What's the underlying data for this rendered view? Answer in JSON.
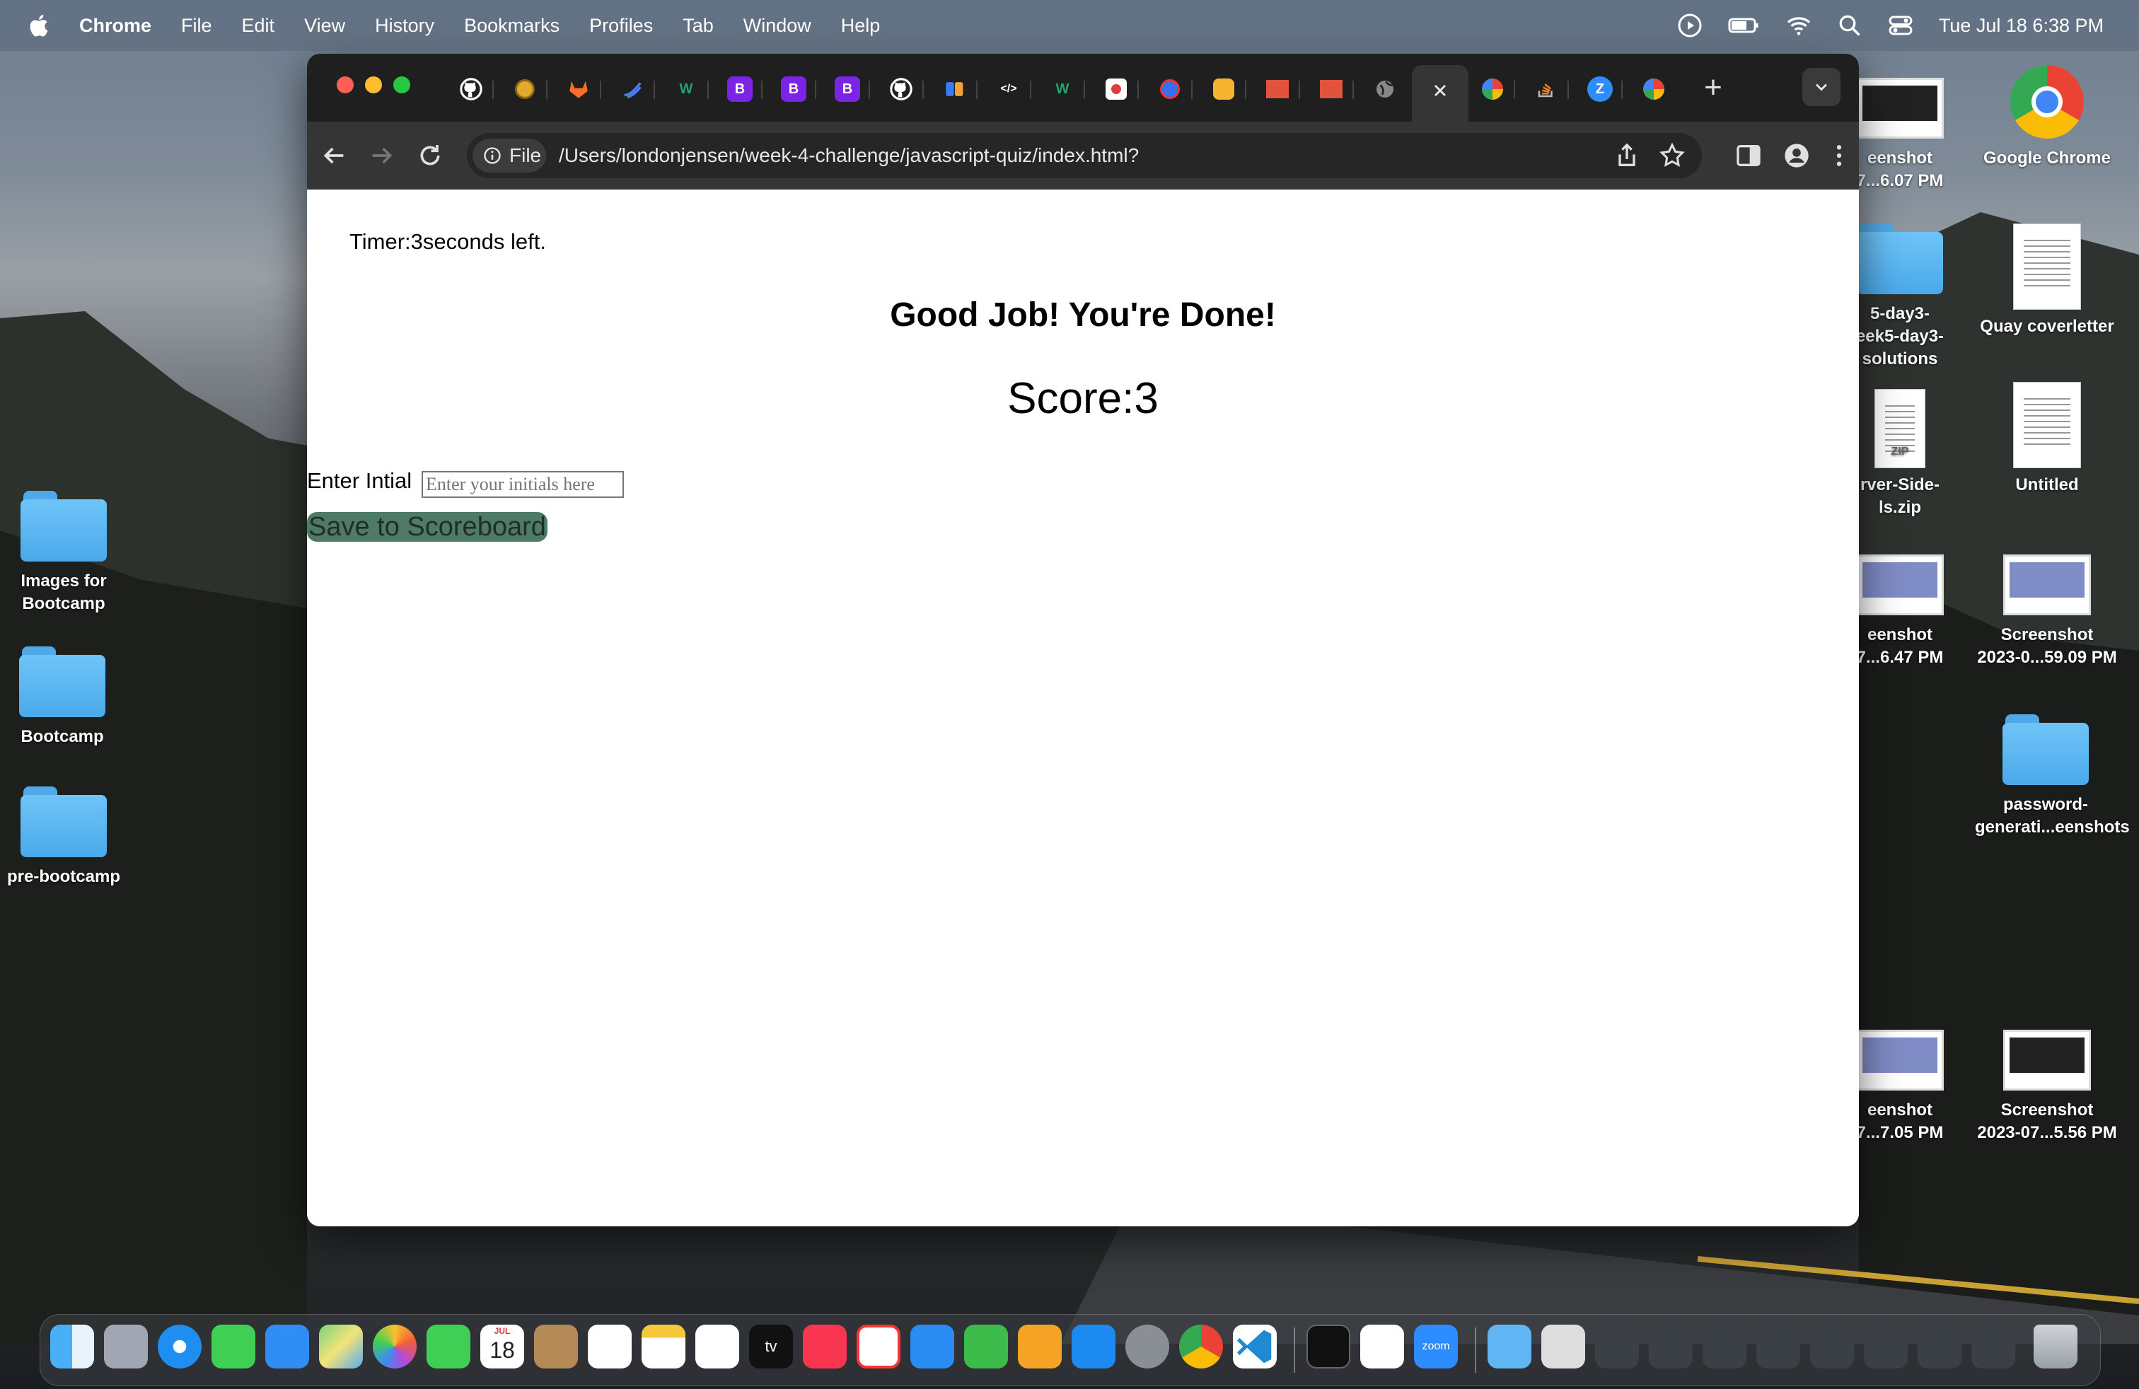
{
  "menubar": {
    "app_name": "Chrome",
    "items": [
      "File",
      "Edit",
      "View",
      "History",
      "Bookmarks",
      "Profiles",
      "Tab",
      "Window",
      "Help"
    ],
    "datetime": "Tue Jul 18  6:38 PM"
  },
  "desktop_left": [
    {
      "label": "Images for\nBootcamp",
      "icon": "folder-icon"
    },
    {
      "label": "Bootcamp",
      "icon": "folder-icon"
    },
    {
      "label": "pre-bootcamp",
      "icon": "folder-icon"
    }
  ],
  "desktop_right": {
    "google_chrome": "Google Chrome",
    "quay_coverletter": "Quay coverletter",
    "untitled": "Untitled",
    "screenshot_1": "Screenshot\n2023-0...59.09 PM",
    "password_folder": "password-\ngenerati...eenshots",
    "screenshot_2": "Screenshot\n2023-07...5.56 PM",
    "partial_1": "eenshot\n7...6.07 PM",
    "partial_2": "5-day3-\neek5-day3-\nsolutions",
    "partial_3": "rver-Side-\nls.zip",
    "partial_4": "eenshot\n7...6.47 PM",
    "partial_5": "eenshot\n7...7.05 PM",
    "zip_tag": "ZIP",
    "trash_label": "Screenshot"
  },
  "browser": {
    "omnibox_chip": "File",
    "url": "/Users/londonjensen/week-4-challenge/javascript-quiz/index.html?",
    "tab_bootstrap_letter": "B",
    "tab_code_glyph": "</>",
    "tab_zoom_letter": "Z"
  },
  "page": {
    "timer_text": "Timer:3seconds left.",
    "heading": "Good Job! You're Done!",
    "score_text": "Score:3",
    "initials_label": "Enter Intial",
    "initials_placeholder": "Enter your initials here",
    "save_button": "Save to Scoreboard"
  },
  "dock": {
    "calendar_month": "JUL",
    "calendar_day": "18",
    "tv_label": "tv",
    "zoom_label": "zoom"
  },
  "colors": {
    "save_button_bg": "#4f7a66",
    "tab_bar": "#1f1f1f",
    "toolbar": "#353535"
  }
}
